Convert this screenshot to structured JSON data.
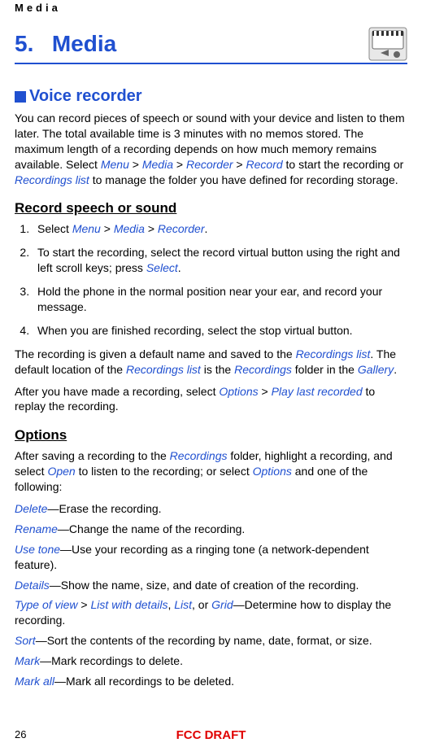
{
  "header_label": "Media",
  "chapter": {
    "num": "5.",
    "title": "Media"
  },
  "section": "Voice recorder",
  "intro": {
    "p1a": "You can record pieces of speech or sound with your device and listen to them later. The total available time is 3 minutes with no memos stored. The maximum length of a recording depends on how much memory remains available. Select ",
    "menu": "Menu",
    "gt": " > ",
    "media": "Media",
    "recorder": "Recorder",
    "record": "Record",
    "p1b": " to start the recording or ",
    "rec_list": "Recordings list",
    "p1c": " to manage the folder you have defined for recording storage."
  },
  "sub_record": "Record speech or sound",
  "steps": {
    "s1a": "Select ",
    "s1_menu": "Menu",
    "s1_media": "Media",
    "s1_recorder": "Recorder",
    "s1_end": ".",
    "s2a": "To start the recording, select the record virtual button using the right and left scroll keys; press ",
    "s2_select": "Select",
    "s2_end": ".",
    "s3": "Hold the phone in the normal position near your ear, and record your message.",
    "s4": "When you are finished recording, select the stop virtual button."
  },
  "after_steps": {
    "p1a": "The recording is given a default name and saved to the ",
    "rec_list": "Recordings list",
    "p1b": ". The default location of the ",
    "rec_list2": "Recordings list",
    "p1c": " is the ",
    "recordings": "Recordings",
    "p1d": " folder in the ",
    "gallery": "Gallery",
    "p1e": ".",
    "p2a": "After you have made a recording, select ",
    "options": "Options",
    "gt": " > ",
    "play_last": "Play last recorded",
    "p2b": " to replay the recording."
  },
  "sub_options": "Options",
  "opts_intro": {
    "a": "After saving a recording to the ",
    "recordings": "Recordings",
    "b": " folder, highlight a recording, and select ",
    "open": "Open",
    "c": " to listen to the recording; or select ",
    "options": "Options",
    "d": " and one of the following:"
  },
  "opts": {
    "delete": {
      "k": "Delete",
      "t": "—Erase the recording."
    },
    "rename": {
      "k": "Rename",
      "t": "—Change the name of the recording."
    },
    "usetone": {
      "k": "Use tone",
      "t": "—Use your recording as a ringing tone (a network-dependent feature)."
    },
    "details": {
      "k": "Details",
      "t": "—Show the name, size, and date of creation of the recording."
    },
    "typeview": {
      "k": "Type of view",
      "gt": " > ",
      "lwd": "List with details",
      "sep1": ", ",
      "list": "List",
      "or": ", or ",
      "grid": "Grid",
      "t": "—Determine how to display the recording."
    },
    "sort": {
      "k": "Sort",
      "t": "—Sort the contents of the recording by name, date, format, or size."
    },
    "mark": {
      "k": "Mark",
      "t": "—Mark recordings to delete."
    },
    "markall": {
      "k": "Mark all",
      "t": "—Mark all recordings to be deleted."
    }
  },
  "footer": {
    "page": "26",
    "fcc": "FCC DRAFT"
  }
}
